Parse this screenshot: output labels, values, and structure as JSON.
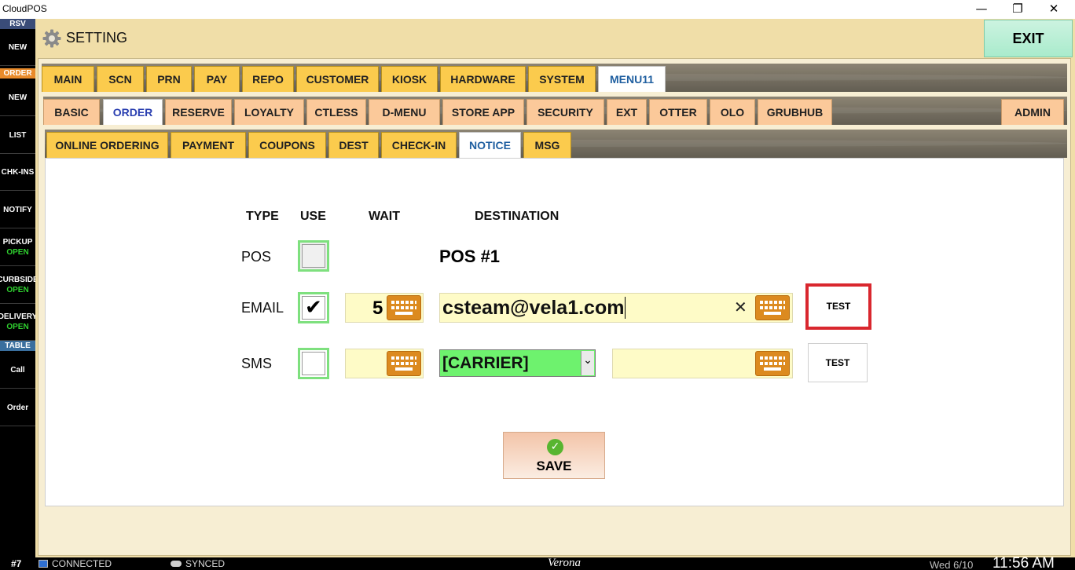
{
  "window": {
    "title": "CloudPOS",
    "minimize_glyph": "—",
    "maximize_glyph": "❐",
    "close_glyph": "✕"
  },
  "sidebar": {
    "rsv_header": "RSV",
    "rsv_new": "NEW",
    "order_header": "ORDER",
    "order_new": "NEW",
    "list": "LIST",
    "chkins": "CHK-INS",
    "notify": "NOTIFY",
    "pickup": "PICKUP",
    "pickup_status": "OPEN",
    "curbside": "CURBSIDE",
    "curbside_status": "OPEN",
    "delivery": "DELIVERY",
    "delivery_status": "OPEN",
    "table_header": "TABLE",
    "call": "Call",
    "order": "Order"
  },
  "header": {
    "title": "SETTING",
    "exit_label": "EXIT"
  },
  "tabs_row1": [
    "MAIN",
    "SCN",
    "PRN",
    "PAY",
    "REPO",
    "CUSTOMER",
    "KIOSK",
    "HARDWARE",
    "SYSTEM",
    "MENU11"
  ],
  "tabs_row2": [
    "BASIC",
    "ORDER",
    "RESERVE",
    "LOYALTY",
    "CTLESS",
    "D-MENU",
    "STORE APP",
    "SECURITY",
    "EXT",
    "OTTER",
    "OLO",
    "GRUBHUB",
    "ADMIN"
  ],
  "tabs_row3": [
    "ONLINE ORDERING",
    "PAYMENT",
    "COUPONS",
    "DEST",
    "CHECK-IN",
    "NOTICE",
    "MSG"
  ],
  "notice": {
    "headers": {
      "type": "TYPE",
      "use": "USE",
      "wait": "WAIT",
      "destination": "DESTINATION"
    },
    "pos": {
      "label": "POS",
      "destination": "POS #1"
    },
    "email": {
      "label": "EMAIL",
      "check_glyph": "✔",
      "wait": "5",
      "destination": "csteam@vela1.com",
      "clear_glyph": "✕",
      "test_label": "TEST"
    },
    "sms": {
      "label": "SMS",
      "carrier": "[CARRIER]",
      "dropdown_glyph": "⌄",
      "test_label": "TEST"
    },
    "save_label": "SAVE",
    "save_check_glyph": "✓"
  },
  "colors": {
    "highlight_red": "#d9272e",
    "check_green": "#7ee07e",
    "carrier_green": "#6ef26e"
  },
  "statusbar": {
    "station": "#7",
    "connected": "CONNECTED",
    "synced": "SYNCED",
    "store": "Verona",
    "date": "Wed 6/10",
    "time": "11:56 AM"
  }
}
